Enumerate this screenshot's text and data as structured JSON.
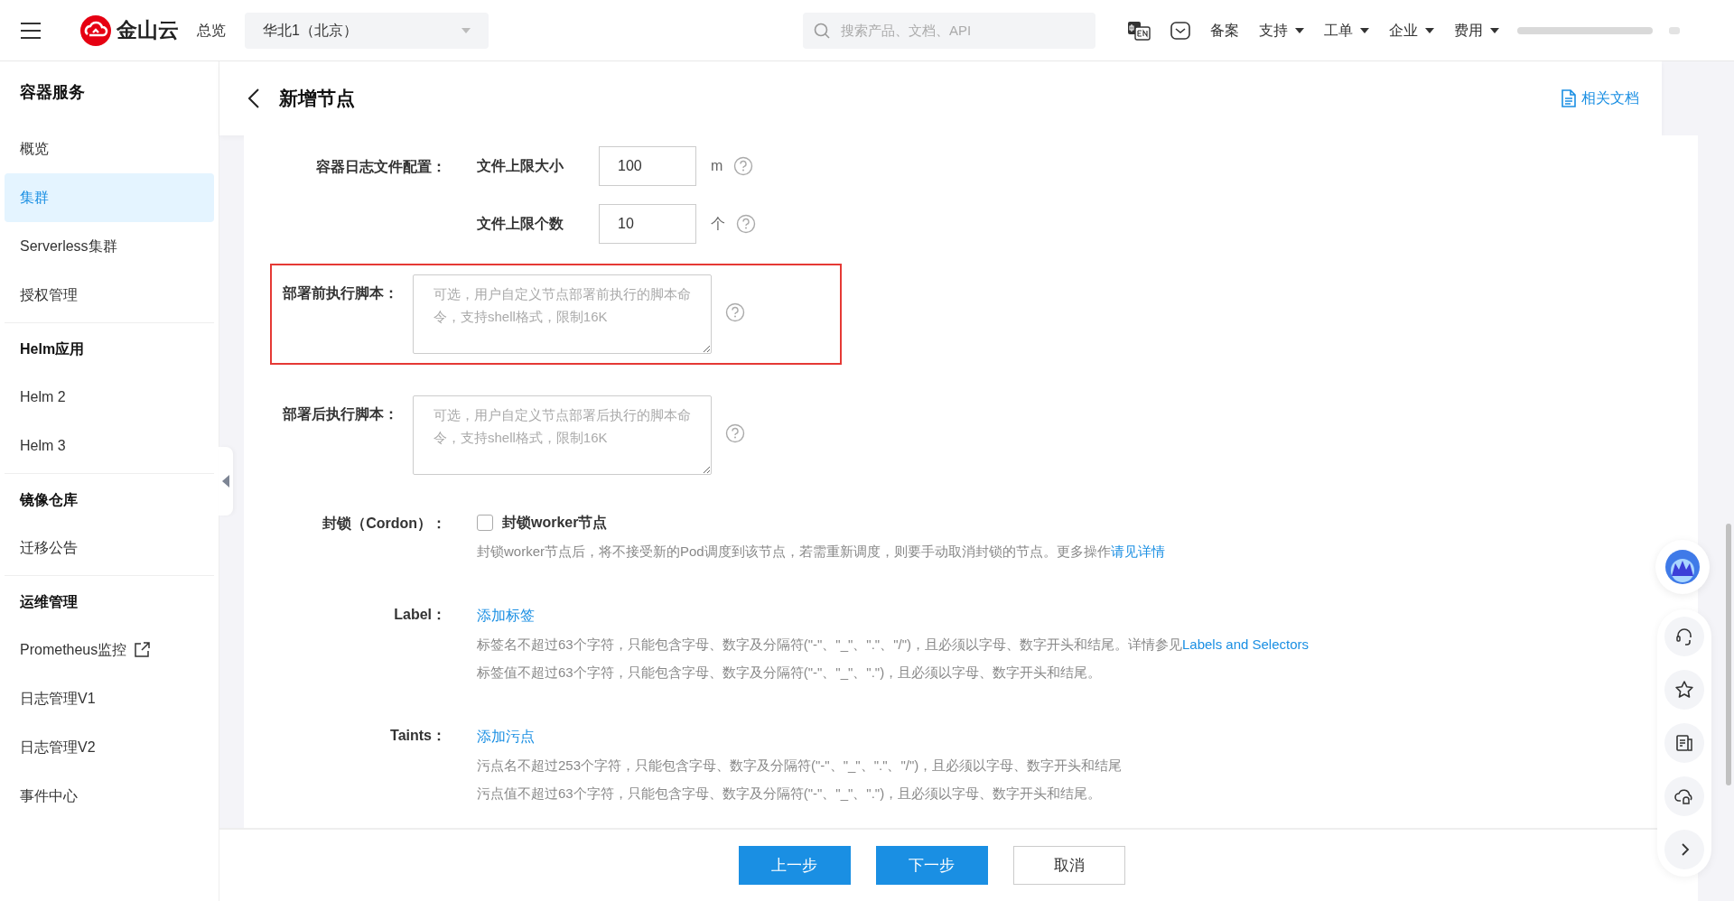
{
  "top_bar": {
    "logo_text": "金山云",
    "overview": "总览",
    "region": "华北1（北京）",
    "search": {
      "placeholder": "搜索产品、文档、API"
    },
    "links": [
      {
        "label": "备案",
        "dropdown": false
      },
      {
        "label": "支持",
        "dropdown": true
      },
      {
        "label": "工单",
        "dropdown": true
      },
      {
        "label": "企业",
        "dropdown": true
      },
      {
        "label": "费用",
        "dropdown": true
      }
    ]
  },
  "sidebar": {
    "title": "容器服务",
    "sections": [
      {
        "items": [
          {
            "label": "概览",
            "selected": false,
            "external": false
          },
          {
            "label": "集群",
            "selected": true,
            "external": false
          },
          {
            "label": "Serverless集群",
            "selected": false,
            "external": false
          },
          {
            "label": "授权管理",
            "selected": false,
            "external": false
          }
        ]
      },
      {
        "heading": "Helm应用",
        "items": [
          {
            "label": "Helm 2",
            "selected": false,
            "external": false
          },
          {
            "label": "Helm 3",
            "selected": false,
            "external": false
          }
        ]
      },
      {
        "heading": "镜像仓库",
        "items": [
          {
            "label": "迁移公告",
            "selected": false,
            "external": false
          }
        ]
      },
      {
        "heading": "运维管理",
        "items": [
          {
            "label": "Prometheus监控",
            "selected": false,
            "external": true
          },
          {
            "label": "日志管理V1",
            "selected": false,
            "external": false
          },
          {
            "label": "日志管理V2",
            "selected": false,
            "external": false
          },
          {
            "label": "事件中心",
            "selected": false,
            "external": false
          }
        ]
      }
    ]
  },
  "page": {
    "title": "新增节点",
    "docs_link": "相关文档"
  },
  "form": [
    {
      "kind": "log_config",
      "label": "容器日志文件配置：",
      "fields": [
        {
          "label": "文件上限大小",
          "value": "100",
          "unit": "m"
        },
        {
          "label": "文件上限个数",
          "value": "10",
          "unit": "个"
        }
      ]
    },
    {
      "kind": "textarea",
      "label": "部署前执行脚本：",
      "placeholder": "可选，用户自定义节点部署前执行的脚本命令，支持shell格式，限制16K",
      "highlighted": true
    },
    {
      "kind": "textarea",
      "label": "部署后执行脚本：",
      "placeholder": "可选，用户自定义节点部署后执行的脚本命令，支持shell格式，限制16K",
      "highlighted": false
    },
    {
      "kind": "checkbox",
      "label": "封锁（Cordon）：",
      "option": "封锁worker节点",
      "checked": false,
      "hints": [
        {
          "text": "封锁worker节点后，将不接受新的Pod调度到该节点，若需重新调度，则要手动取消封锁的节点。更多操作",
          "link": "请见详情"
        }
      ]
    },
    {
      "kind": "links",
      "label": "Label：",
      "action": "添加标签",
      "hints": [
        {
          "text": "标签名不超过63个字符，只能包含字母、数字及分隔符(\"-\"、\"_\"、\".\"、\"/\")，且必须以字母、数字开头和结尾。详情参见",
          "link": "Labels and Selectors"
        },
        {
          "text": "标签值不超过63个字符，只能包含字母、数字及分隔符(\"-\"、\"_\"、\".\")，且必须以字母、数字开头和结尾。"
        }
      ]
    },
    {
      "kind": "links",
      "label": "Taints：",
      "action": "添加污点",
      "hints": [
        {
          "text": "污点名不超过253个字符，只能包含字母、数字及分隔符(\"-\"、\"_\"、\".\"、\"/\")，且必须以字母、数字开头和结尾"
        },
        {
          "text": "污点值不超过63个字符，只能包含字母、数字及分隔符(\"-\"、\"_\"、\".\")，且必须以字母、数字开头和结尾。"
        }
      ]
    }
  ],
  "footer": {
    "buttons": [
      {
        "label": "上一步",
        "kind": "primary"
      },
      {
        "label": "下一步",
        "kind": "primary"
      },
      {
        "label": "取消",
        "kind": "default"
      }
    ]
  }
}
